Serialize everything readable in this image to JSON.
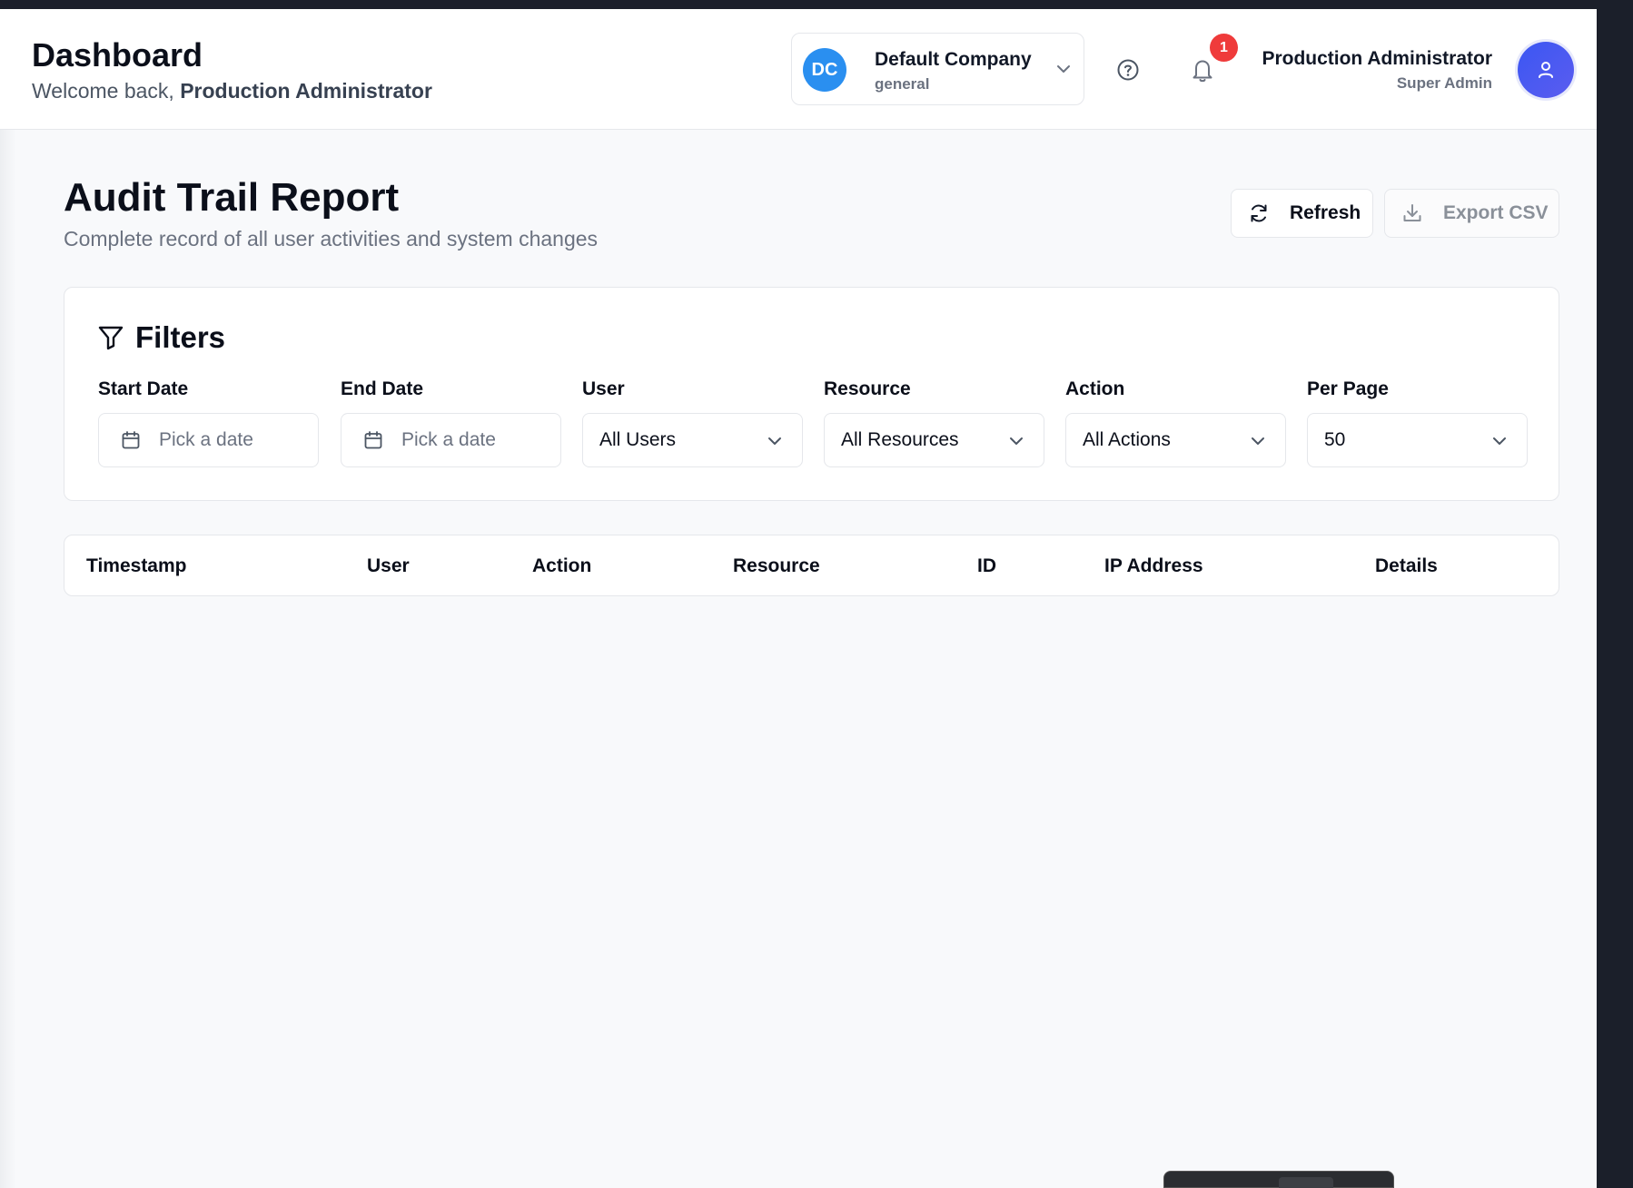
{
  "header": {
    "title": "Dashboard",
    "welcome_prefix": "Welcome back,",
    "welcome_name": "Production Administrator",
    "company": {
      "initials": "DC",
      "name": "Default Company",
      "sub": "general"
    },
    "notifications_count": "1",
    "user": {
      "name": "Production Administrator",
      "role": "Super Admin"
    }
  },
  "page": {
    "title": "Audit Trail Report",
    "subtitle": "Complete record of all user activities and system changes",
    "refresh_label": "Refresh",
    "export_label": "Export CSV"
  },
  "filters": {
    "title": "Filters",
    "start_date": {
      "label": "Start Date",
      "placeholder": "Pick a date"
    },
    "end_date": {
      "label": "End Date",
      "placeholder": "Pick a date"
    },
    "user": {
      "label": "User",
      "value": "All Users"
    },
    "resource": {
      "label": "Resource",
      "value": "All Resources"
    },
    "action": {
      "label": "Action",
      "value": "All Actions"
    },
    "per_page": {
      "label": "Per Page",
      "value": "50"
    }
  },
  "table": {
    "columns": [
      "Timestamp",
      "User",
      "Action",
      "Resource",
      "ID",
      "IP Address",
      "Details"
    ]
  },
  "colors": {
    "accent": "#2a8ff0",
    "avatar": "#4a58f1",
    "badge": "#ef3b3b",
    "page_bg": "#f8f9fb"
  },
  "icons": [
    "chevron-down-icon",
    "help-circle-icon",
    "bell-icon",
    "user-icon",
    "refresh-icon",
    "download-icon",
    "filter-icon",
    "calendar-icon"
  ]
}
